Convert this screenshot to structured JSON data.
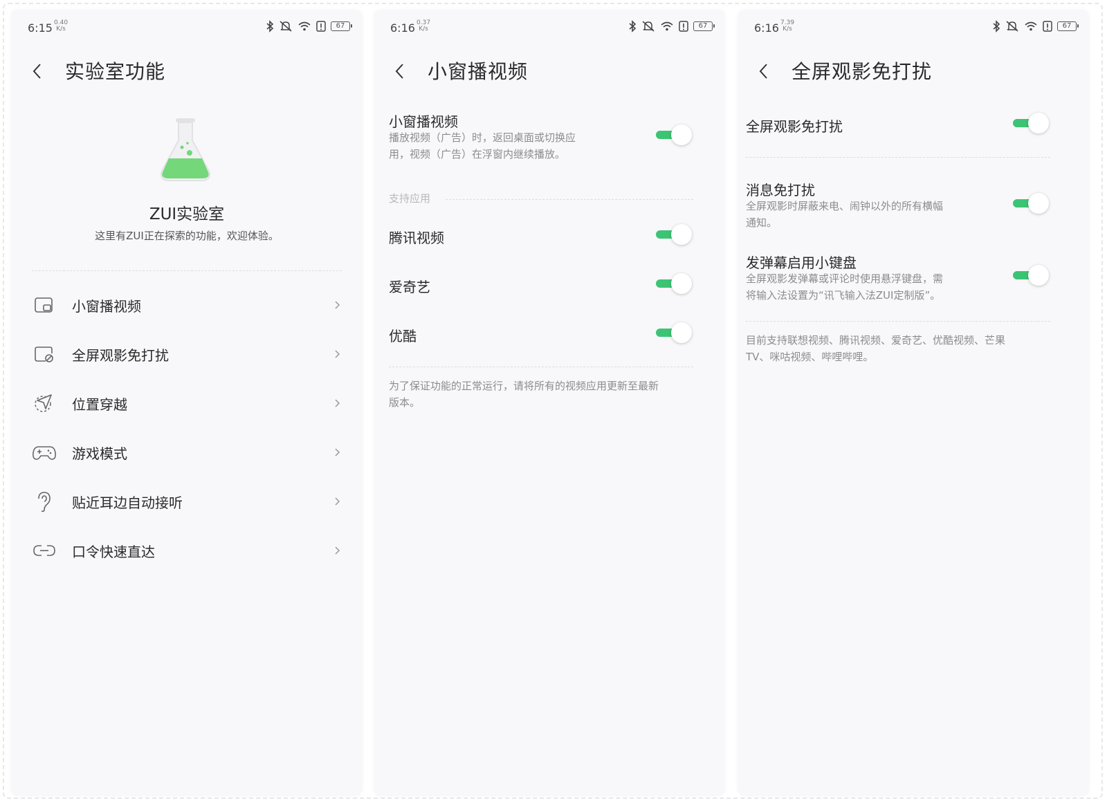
{
  "colors": {
    "accent": "#3cc474",
    "panel_bg": "#f8f7fa",
    "text_primary": "#2a2a2a",
    "text_secondary": "#8c8c8c"
  },
  "panels": [
    {
      "status": {
        "time": "6:15",
        "speed_value": "0.40",
        "speed_unit": "K/s",
        "battery": "67"
      },
      "title": "实验室功能",
      "lab_title": "ZUI实验室",
      "lab_subtitle": "这里有ZUI正在探索的功能，欢迎体验。",
      "menu": [
        {
          "label": "小窗播视频",
          "icon": "picture-in-picture-icon"
        },
        {
          "label": "全屏观影免打扰",
          "icon": "fullscreen-dnd-icon"
        },
        {
          "label": "位置穿越",
          "icon": "location-travel-icon"
        },
        {
          "label": "游戏模式",
          "icon": "gamepad-icon"
        },
        {
          "label": "贴近耳边自动接听",
          "icon": "ear-icon"
        },
        {
          "label": "口令快速直达",
          "icon": "link-icon"
        }
      ]
    },
    {
      "status": {
        "time": "6:16",
        "speed_value": "0.37",
        "speed_unit": "K/s",
        "battery": "67"
      },
      "title": "小窗播视频",
      "main_toggle": {
        "title": "小窗播视频",
        "desc_line1": "播放视频（广告）时，返回桌面或切换应",
        "desc_line2": "用，视频（广告）在浮窗内继续播放。",
        "on": true
      },
      "section_label": "支持应用",
      "apps": [
        {
          "label": "腾讯视频",
          "on": true
        },
        {
          "label": "爱奇艺",
          "on": true
        },
        {
          "label": "优酷",
          "on": true
        }
      ],
      "note_line1": "为了保证功能的正常运行，请将所有的视频应用更新至最新",
      "note_line2": "版本。"
    },
    {
      "status": {
        "time": "6:16",
        "speed_value": "7.39",
        "speed_unit": "K/s",
        "battery": "67"
      },
      "title": "全屏观影免打扰",
      "main_toggle": {
        "title": "全屏观影免打扰",
        "on": true
      },
      "options": [
        {
          "title": "消息免打扰",
          "desc_line1": "全屏观影时屏蔽来电、闹钟以外的所有横幅",
          "desc_line2": "通知。",
          "on": true
        },
        {
          "title": "发弹幕启用小键盘",
          "desc_line1": "全屏观影发弹幕或评论时使用悬浮键盘，需",
          "desc_line2": "将输入法设置为“讯飞输入法ZUI定制版”。",
          "on": true
        }
      ],
      "note_line1": "目前支持联想视频、腾讯视频、爱奇艺、优酷视频、芒果",
      "note_line2": "TV、咪咕视频、哔哩哔哩。"
    }
  ]
}
